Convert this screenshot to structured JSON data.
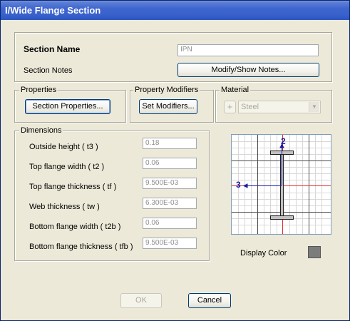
{
  "window": {
    "title": "I/Wide Flange Section"
  },
  "section": {
    "name_label": "Section Name",
    "name_value": "IPN",
    "notes_label": "Section Notes",
    "notes_button": "Modify/Show Notes..."
  },
  "properties": {
    "legend": "Properties",
    "button": "Section Properties..."
  },
  "modifiers": {
    "legend": "Property Modifiers",
    "button": "Set Modifiers..."
  },
  "material": {
    "legend": "Material",
    "add_button": "+",
    "selected": "Steel"
  },
  "dimensions": {
    "legend": "Dimensions",
    "rows": [
      {
        "label": "Outside height  ( t3 )",
        "value": "0.18"
      },
      {
        "label": "Top flange width  ( t2 )",
        "value": "0.06"
      },
      {
        "label": "Top flange thickness  ( tf )",
        "value": "9.500E-03"
      },
      {
        "label": "Web thickness  ( tw )",
        "value": "6.300E-03"
      },
      {
        "label": "Bottom flange width  ( t2b )",
        "value": "0.06"
      },
      {
        "label": "Bottom flange thickness  ( tfb )",
        "value": "9.500E-03"
      }
    ]
  },
  "preview": {
    "axis2_label": "2",
    "axis3_label": "3"
  },
  "display_color": {
    "label": "Display Color",
    "color": "#7c7c7c"
  },
  "footer": {
    "ok": "OK",
    "cancel": "Cancel"
  },
  "colors": {
    "titlebar": "#2b55c2",
    "axis": "#1a1aa6",
    "centerline": "#e03030",
    "section_fill": "#c0c0c0"
  }
}
